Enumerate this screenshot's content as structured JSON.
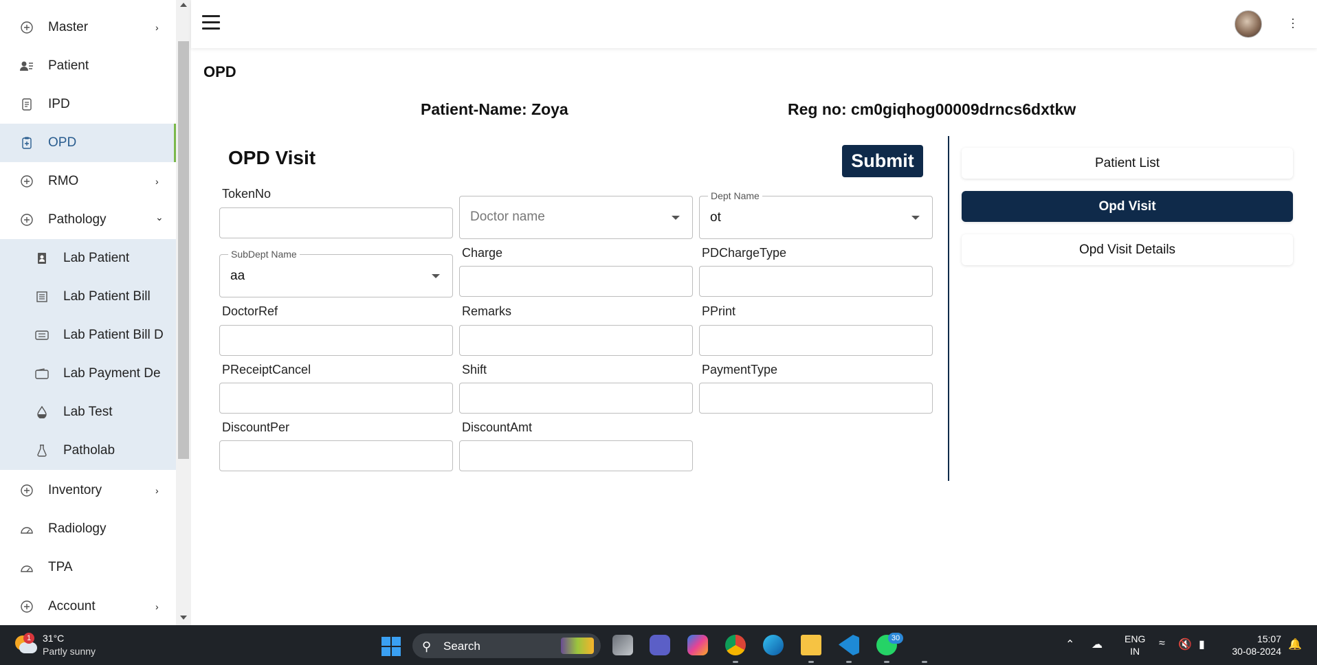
{
  "sidebar": {
    "items": [
      {
        "label": "Master",
        "icon": "plus-circle-icon",
        "chevron": "›"
      },
      {
        "label": "Patient",
        "icon": "patient-icon"
      },
      {
        "label": "IPD",
        "icon": "document-icon"
      },
      {
        "label": "OPD",
        "icon": "clipboard-icon",
        "active": true
      },
      {
        "label": "RMO",
        "icon": "plus-circle-icon",
        "chevron": "›"
      },
      {
        "label": "Pathology",
        "icon": "plus-circle-icon",
        "chevron": "⌄"
      },
      {
        "label": "Lab Patient",
        "icon": "id-card-icon"
      },
      {
        "label": "Lab Patient Bill",
        "icon": "bill-icon"
      },
      {
        "label": "Lab Patient Bill D",
        "icon": "ticket-icon"
      },
      {
        "label": "Lab Payment De",
        "icon": "wallet-icon"
      },
      {
        "label": "Lab Test",
        "icon": "drop-icon"
      },
      {
        "label": "Patholab",
        "icon": "flask-icon"
      },
      {
        "label": "Inventory",
        "icon": "plus-circle-icon",
        "chevron": "›"
      },
      {
        "label": "Radiology",
        "icon": "gauge-icon"
      },
      {
        "label": "TPA",
        "icon": "gauge-icon"
      },
      {
        "label": "Account",
        "icon": "plus-circle-icon",
        "chevron": "›"
      }
    ]
  },
  "main": {
    "page_title": "OPD",
    "patient_name": "Patient-Name: Zoya",
    "reg_no": "Reg no: cm0giqhog00009drncs6dxtkw",
    "form_title": "OPD Visit",
    "submit_label": "Submit",
    "fields": {
      "token_no": "TokenNo",
      "doctor_name_placeholder": "Doctor name",
      "dept_name_label": "Dept Name",
      "dept_name_value": "ot",
      "subdept_label": "SubDept Name",
      "subdept_value": "aa",
      "charge": "Charge",
      "pd_charge_type": "PDChargeType",
      "doctor_ref": "DoctorRef",
      "remarks": "Remarks",
      "pprint": "PPrint",
      "preceipt_cancel": "PReceiptCancel",
      "shift": "Shift",
      "payment_type": "PaymentType",
      "discount_per": "DiscountPer",
      "discount_amt": "DiscountAmt"
    }
  },
  "right_panel": {
    "patient_list": "Patient List",
    "opd_visit": "Opd Visit",
    "opd_visit_details": "Opd Visit Details"
  },
  "taskbar": {
    "weather_badge": "1",
    "temperature": "31°C",
    "condition": "Partly sunny",
    "search_label": "Search",
    "whatsapp_badge": "30",
    "lang_line1": "ENG",
    "lang_line2": "IN",
    "time": "15:07",
    "date": "30-08-2024"
  },
  "colors": {
    "primary": "#0f2a4a",
    "active_bg": "#e3ebf3",
    "active_accent": "#7ab84a"
  }
}
